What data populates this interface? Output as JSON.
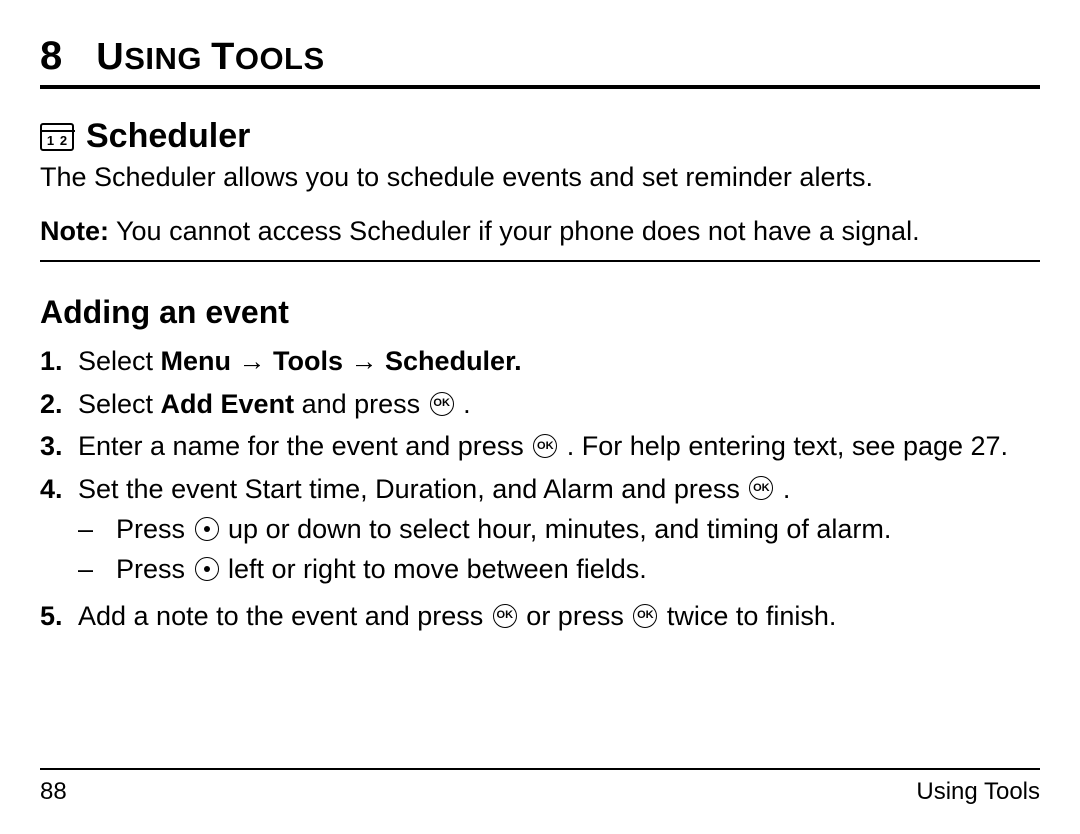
{
  "chapter": {
    "number": "8",
    "title_caps": "U",
    "title_rest_1": "SING ",
    "title_caps2": "T",
    "title_rest_2": "OOLS"
  },
  "section": {
    "icon_digits": [
      "1",
      "2"
    ],
    "heading": "Scheduler",
    "intro": "The Scheduler allows you to schedule events and set reminder alerts.",
    "note_label": "Note:",
    "note_text": " You cannot access Scheduler if your phone does not have a signal."
  },
  "subsection": {
    "heading": "Adding an event",
    "steps": {
      "s1": {
        "num": "1.",
        "pre": "Select ",
        "bold": "Menu → Tools → Scheduler."
      },
      "s2": {
        "num": "2.",
        "pre": "Select ",
        "bold": "Add Event",
        "post": " and press ",
        "tail": " ."
      },
      "s3": {
        "num": "3.",
        "text_a": "Enter a name for the event and press ",
        "text_b": " . For help entering text, see page 27."
      },
      "s4": {
        "num": "4.",
        "text_a": "Set the event Start time, Duration, and Alarm and press ",
        "text_b": " .",
        "sub1_a": "Press ",
        "sub1_b": " up or down to select hour, minutes, and timing of alarm.",
        "sub2_a": "Press ",
        "sub2_b": " left or right to move between fields."
      },
      "s5": {
        "num": "5.",
        "text_a": "Add a note to the event and press ",
        "text_b": " or press ",
        "text_c": " twice to finish."
      }
    }
  },
  "footer": {
    "page": "88",
    "label": "Using Tools"
  },
  "glyph": {
    "ok": "OK"
  }
}
